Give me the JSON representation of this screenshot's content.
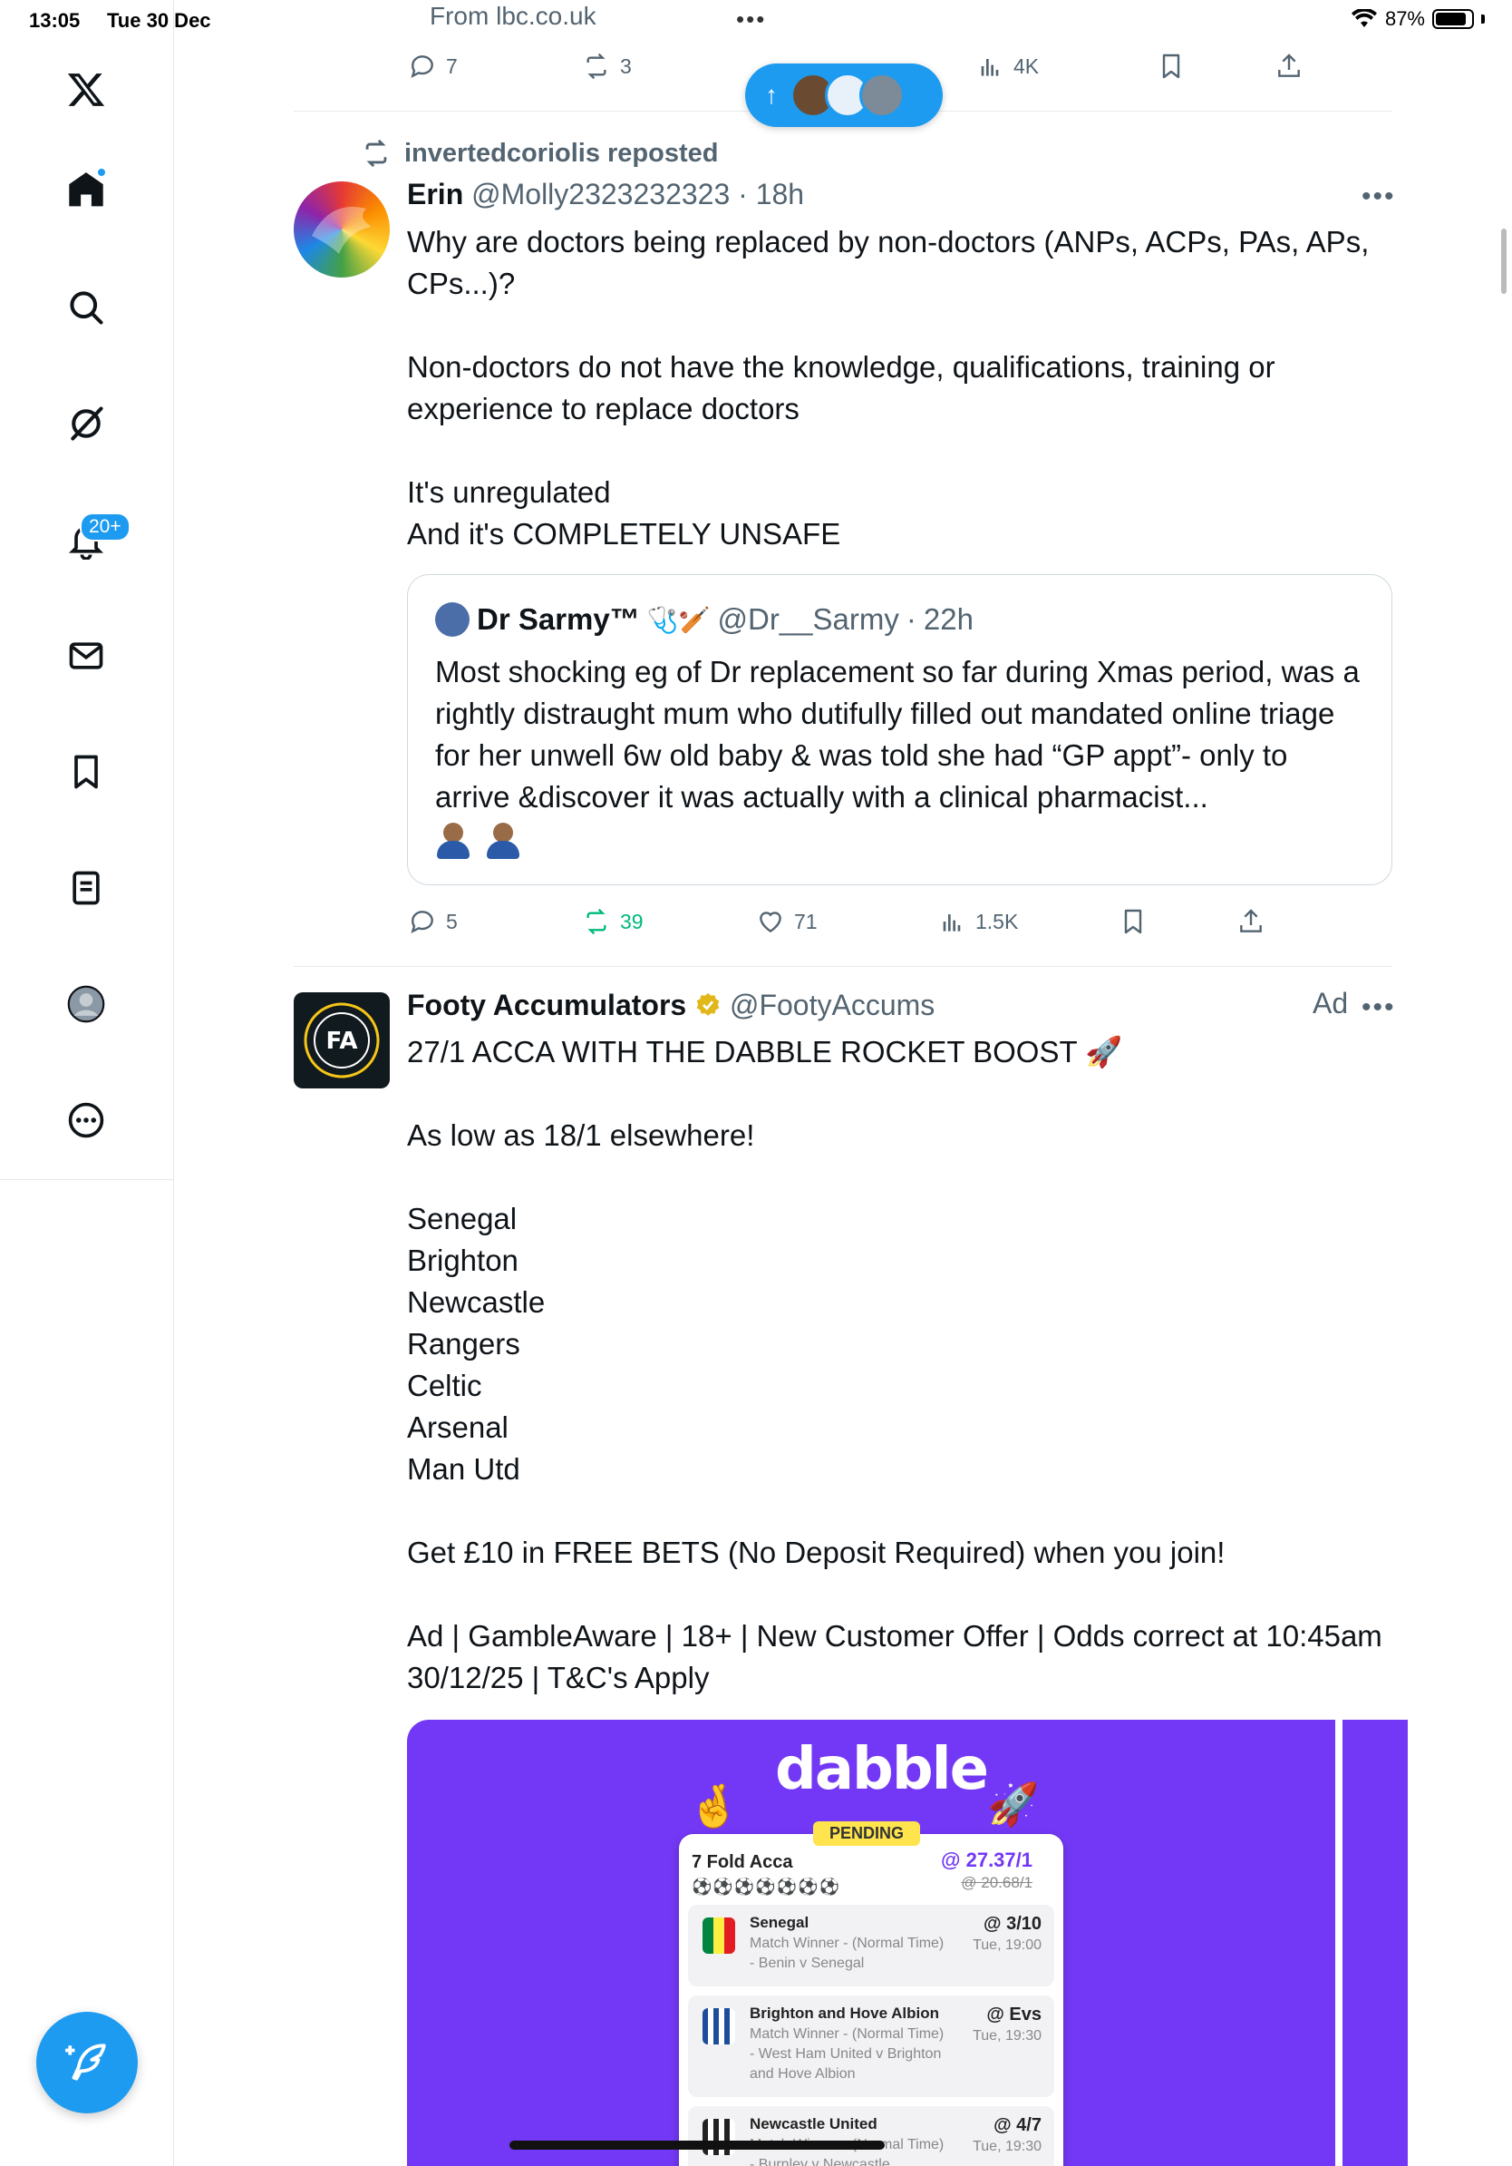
{
  "status_bar": {
    "time": "13:05",
    "date": "Tue 30 Dec",
    "battery": "87%",
    "battery_level": 0.87
  },
  "sidebar": {
    "notifications_badge": "20+"
  },
  "previous_tweet": {
    "source_link": "From lbc.co.uk",
    "replies": "7",
    "reposts": "3",
    "views": "4K"
  },
  "repost_banner": {
    "text": "invertedcoriolis reposted"
  },
  "tweet": {
    "name": "Erin",
    "handle": "@Molly2323232323",
    "time": "18h",
    "text": "Why are doctors being replaced by non-doctors (ANPs, ACPs, PAs, APs, CPs...)?\n\nNon-doctors do not have the knowledge, qualifications, training or experience to replace doctors\n\nIt's unregulated\nAnd it's COMPLETELY UNSAFE",
    "replies": "5",
    "reposts": "39",
    "likes": "71",
    "views": "1.5K"
  },
  "quote": {
    "name": "Dr Sarmy™",
    "handle": "@Dr__Sarmy",
    "time": "22h",
    "text": "Most shocking eg of Dr replacement so far during Xmas period, was a rightly distraught mum who dutifully filled out mandated online triage for her unwell 6w old baby & was told she had “GP appt”- only to arrive &discover it was actually with a clinical pharmacist..."
  },
  "ad_tweet": {
    "name": "Footy Accumulators",
    "handle": "@FootyAccums",
    "ad_label": "Ad",
    "text": "27/1 ACCA WITH THE DABBLE ROCKET BOOST 🚀\n\nAs low as 18/1 elsewhere!\n\nSenegal\nBrighton\nNewcastle\nRangers\nCeltic\nArsenal\nMan Utd\n\nGet £10 in FREE BETS (No Deposit Required) when you join!\n\nAd | GambleAware | 18+ | New Customer Offer | Odds correct at 10:45am 30/12/25 | T&C's Apply"
  },
  "ad_image": {
    "logo": "dabble",
    "badge": "PENDING",
    "acca_title": "7 Fold Acca",
    "acca_odds": "@ 27.37/1",
    "acca_old_odds": "@ 20.68/1",
    "legs": [
      {
        "team": "Senegal",
        "desc": "Match Winner - (Normal Time) - Benin v Senegal",
        "odds": "@ 3/10",
        "time": "Tue, 19:00"
      },
      {
        "team": "Brighton and Hove Albion",
        "desc": "Match Winner - (Normal Time) - West Ham United v Brighton and Hove Albion",
        "odds": "@ Evs",
        "time": "Tue, 19:30"
      },
      {
        "team": "Newcastle United",
        "desc": "Match Winner - (Normal Time) - Burnley v Newcastle",
        "odds": "@ 4/7",
        "time": "Tue, 19:30"
      }
    ]
  },
  "colors": {
    "accent": "#1d9bf0",
    "repost_green": "#00ba7c",
    "secondary_text": "#536471",
    "dabble_purple": "#7338f5"
  }
}
